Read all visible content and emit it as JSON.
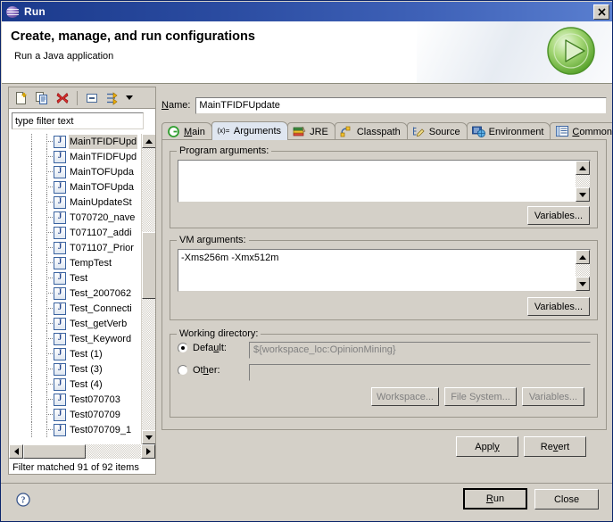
{
  "window": {
    "title": "Run",
    "icon": "eclipse-icon",
    "close_label": "×"
  },
  "header": {
    "title": "Create, manage, and run configurations",
    "subtitle": "Run a Java application",
    "icon": "run-play-icon"
  },
  "sidebar": {
    "toolbar": [
      {
        "name": "new-launch-configuration-icon",
        "tooltip": "New launch configuration"
      },
      {
        "name": "duplicate-icon",
        "tooltip": "Duplicate"
      },
      {
        "name": "delete-icon",
        "tooltip": "Delete"
      },
      {
        "name": "collapse-all-icon",
        "tooltip": "Collapse All"
      },
      {
        "name": "filter-icon",
        "tooltip": "Filter"
      },
      {
        "name": "view-menu-chevron-icon",
        "tooltip": "View Menu"
      }
    ],
    "filter": {
      "value": "type filter text",
      "placeholder": "type filter text"
    },
    "items": [
      {
        "label": "MainTFIDFUpd",
        "selected": true
      },
      {
        "label": "MainTFIDFUpd",
        "selected": false
      },
      {
        "label": "MainTOFUpda",
        "selected": false
      },
      {
        "label": "MainTOFUpda",
        "selected": false
      },
      {
        "label": "MainUpdateSt",
        "selected": false
      },
      {
        "label": "T070720_nave",
        "selected": false
      },
      {
        "label": "T071107_addi",
        "selected": false
      },
      {
        "label": "T071107_Prior",
        "selected": false
      },
      {
        "label": "TempTest",
        "selected": false
      },
      {
        "label": "Test",
        "selected": false
      },
      {
        "label": "Test_2007062",
        "selected": false
      },
      {
        "label": "Test_Connecti",
        "selected": false
      },
      {
        "label": "Test_getVerb",
        "selected": false
      },
      {
        "label": "Test_Keyword",
        "selected": false
      },
      {
        "label": "Test (1)",
        "selected": false
      },
      {
        "label": "Test (3)",
        "selected": false
      },
      {
        "label": "Test (4)",
        "selected": false
      },
      {
        "label": "Test070703",
        "selected": false
      },
      {
        "label": "Test070709",
        "selected": false
      },
      {
        "label": "Test070709_1",
        "selected": false
      }
    ],
    "status": "Filter matched 91 of 92 items"
  },
  "config": {
    "name_label": "Name:",
    "name_value": "MainTFIDFUpdate",
    "tabs": [
      {
        "label": "Main",
        "icon": "main-green-g-icon",
        "active": false
      },
      {
        "label": "Arguments",
        "icon": "arguments-xequals-icon",
        "active": true
      },
      {
        "label": "JRE",
        "icon": "jre-books-icon",
        "active": false
      },
      {
        "label": "Classpath",
        "icon": "classpath-icon",
        "active": false
      },
      {
        "label": "Source",
        "icon": "source-pencil-icon",
        "active": false
      },
      {
        "label": "Environment",
        "icon": "environment-icon",
        "active": false
      },
      {
        "label": "Common",
        "icon": "common-list-icon",
        "active": false
      }
    ],
    "program_arguments": {
      "legend": "Program arguments:",
      "value": "",
      "variables_button": "Variables..."
    },
    "vm_arguments": {
      "legend": "VM arguments:",
      "value": "-Xms256m -Xmx512m",
      "variables_button": "Variables..."
    },
    "working_directory": {
      "legend": "Working directory:",
      "default_label": "Default:",
      "default_selected": true,
      "default_value": "${workspace_loc:OpinionMining}",
      "other_label": "Other:",
      "other_selected": false,
      "other_value": "",
      "workspace_button": "Workspace...",
      "file_system_button": "File System...",
      "variables_button": "Variables..."
    },
    "apply_button": "Apply",
    "revert_button": "Revert"
  },
  "footer": {
    "help_icon": "help-question-icon",
    "run_button": "Run",
    "close_button": "Close"
  },
  "colors": {
    "title_bar_start": "#1b3a8c",
    "title_bar_end": "#5a7fd0",
    "dialog_bg": "#d4d0c8",
    "active_tab_bg": "#dfe6f0",
    "accent_green": "#7ac142"
  }
}
